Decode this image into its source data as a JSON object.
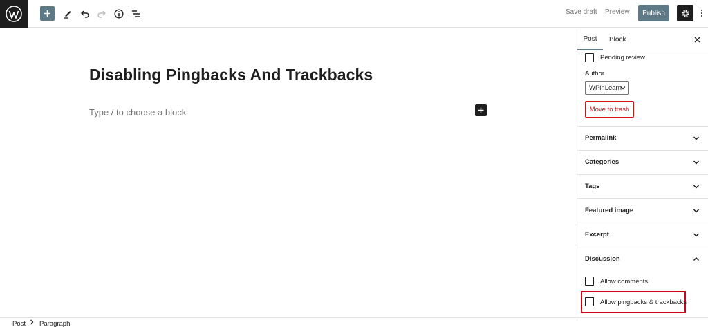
{
  "toolbar": {
    "save_draft": "Save draft",
    "preview": "Preview",
    "publish": "Publish"
  },
  "editor": {
    "title": "Disabling Pingbacks And Trackbacks",
    "placeholder": "Type / to choose a block"
  },
  "sidebar": {
    "tabs": [
      {
        "label": "Post",
        "active": true
      },
      {
        "label": "Block",
        "active": false
      }
    ],
    "pending_review": {
      "label": "Pending review",
      "checked": false
    },
    "author": {
      "label": "Author",
      "value": "WPinLearn"
    },
    "move_to_trash": "Move to trash",
    "panels": [
      {
        "title": "Permalink",
        "expanded": false
      },
      {
        "title": "Categories",
        "expanded": false
      },
      {
        "title": "Tags",
        "expanded": false
      },
      {
        "title": "Featured image",
        "expanded": false
      },
      {
        "title": "Excerpt",
        "expanded": false
      },
      {
        "title": "Discussion",
        "expanded": true
      }
    ],
    "discussion": {
      "allow_comments": {
        "label": "Allow comments",
        "checked": false
      },
      "allow_pingbacks": {
        "label": "Allow pingbacks & trackbacks",
        "checked": false
      }
    }
  },
  "breadcrumb": {
    "items": [
      "Post",
      "Paragraph"
    ]
  },
  "colors": {
    "accent": "#5e7a87",
    "dark": "#1e1e1e",
    "danger": "#cc1818",
    "highlight": "#d0021b"
  }
}
